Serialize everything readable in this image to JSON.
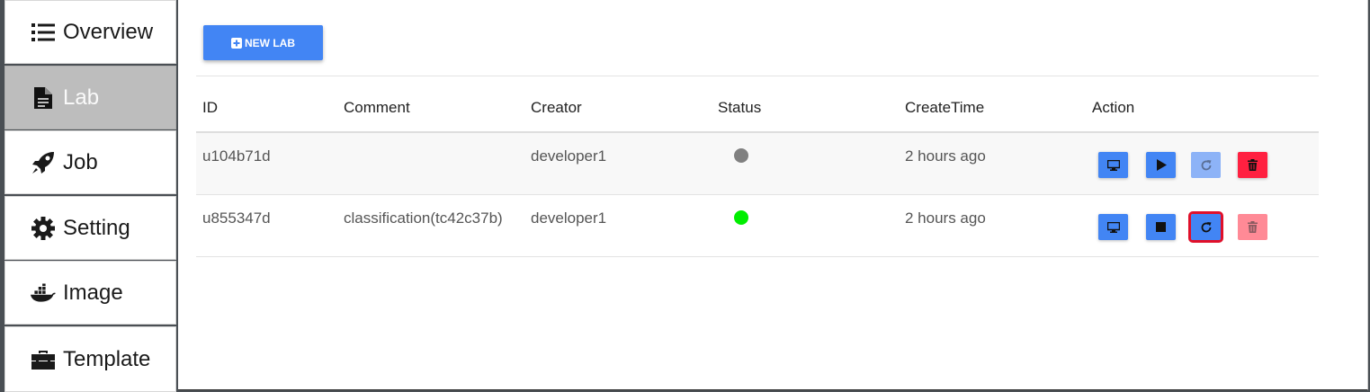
{
  "sidebar": {
    "items": [
      {
        "label": "Overview",
        "icon": "list-icon",
        "active": false
      },
      {
        "label": "Lab",
        "icon": "file-icon",
        "active": true
      },
      {
        "label": "Job",
        "icon": "rocket-icon",
        "active": false
      },
      {
        "label": "Setting",
        "icon": "gear-icon",
        "active": false
      },
      {
        "label": "Image",
        "icon": "docker-icon",
        "active": false
      },
      {
        "label": "Template",
        "icon": "toolbox-icon",
        "active": false
      }
    ]
  },
  "toolbar": {
    "new_lab_label": "NEW LAB",
    "new_lab_icon": "plus-square-icon"
  },
  "table": {
    "headers": {
      "id": "ID",
      "comment": "Comment",
      "creator": "Creator",
      "status": "Status",
      "create_time": "CreateTime",
      "action": "Action"
    },
    "rows": [
      {
        "id": "u104b71d",
        "comment": "",
        "creator": "developer1",
        "status": "stopped",
        "status_color": "#808080",
        "create_time": "2 hours ago",
        "actions": [
          {
            "icon": "monitor-icon",
            "name": "open",
            "enabled": true
          },
          {
            "icon": "play-icon",
            "name": "start",
            "enabled": true
          },
          {
            "icon": "refresh-icon",
            "name": "restart",
            "enabled": false
          },
          {
            "icon": "trash-icon",
            "name": "delete",
            "enabled": true
          }
        ]
      },
      {
        "id": "u855347d",
        "comment": "classification(tc42c37b)",
        "creator": "developer1",
        "status": "running",
        "status_color": "#00ee00",
        "create_time": "2 hours ago",
        "actions": [
          {
            "icon": "monitor-icon",
            "name": "open",
            "enabled": true
          },
          {
            "icon": "stop-icon",
            "name": "stop",
            "enabled": true
          },
          {
            "icon": "refresh-icon",
            "name": "restart",
            "enabled": true,
            "focused": true
          },
          {
            "icon": "trash-icon",
            "name": "delete",
            "enabled": false
          }
        ]
      }
    ]
  },
  "colors": {
    "primary": "#4285f4",
    "danger": "#ff2040",
    "status_running": "#00ee00",
    "status_stopped": "#808080"
  }
}
